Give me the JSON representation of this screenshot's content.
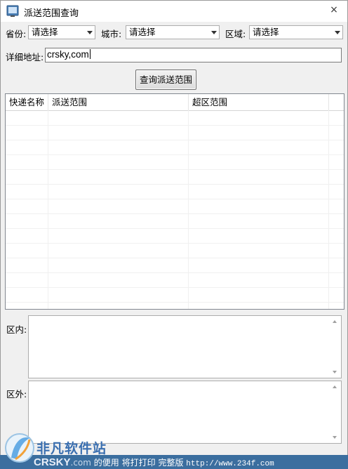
{
  "window": {
    "title": "派送范围查询",
    "close_glyph": "×"
  },
  "filters": {
    "province_label": "省份:",
    "province_value": "请选择",
    "city_label": "城市:",
    "city_value": "请选择",
    "district_label": "区域:",
    "district_value": "请选择"
  },
  "address": {
    "label": "详细地址:",
    "value": "crsky,com"
  },
  "query_button": "查询派送范围",
  "grid": {
    "columns": [
      "快递名称",
      "派送范围",
      "超区范围"
    ]
  },
  "inside": {
    "label": "区内:"
  },
  "outside": {
    "label": "区外:"
  },
  "watermark": {
    "site_name": "非凡软件站",
    "crsky": "CRSKY",
    "dotcom": ".com",
    "footer_a": "的便用",
    "footer_b": "将打打印 完整版",
    "url": "http://www.234f.com"
  }
}
